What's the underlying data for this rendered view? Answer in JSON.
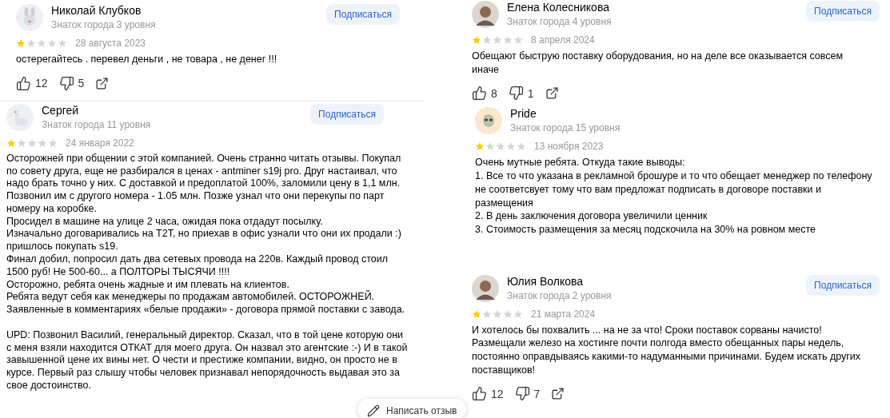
{
  "columns": [
    {
      "reviews": [
        {
          "avatar": {
            "kind": "bunny"
          },
          "name": "Николай Клубков",
          "level": "Знаток города 3 уровня",
          "subscribe": "Подписаться",
          "stars": 1,
          "date": "28 августа 2023",
          "text": "остерегайтесь . перевел деньги , не товара , не денег !!!",
          "likes": "12",
          "dislikes": "5"
        },
        {
          "avatar": {
            "kind": "goose"
          },
          "name": "Сергей",
          "level": "Знаток города 11 уровня",
          "subscribe": "Подписаться",
          "stars": 1,
          "date": "24 января 2022",
          "text": "Осторожней при общении с этой компанией. Очень странно читать отзывы. Покупал\nпо совету друга, еще не разбирался в ценах - antminer s19j pro. Друг настаивал, что\nнадо брать точно у них. С доставкой и предоплатой 100%, заломили цену в 1,1 млн.\nПозвонил им с другого номера - 1.05 млн. Позже узнал что они перекупы по парт\nномеру на коробке.\nПросидел в машине на улице 2 часа, ожидая пока отдадут посылку.\nИзначально договаривались на T2T, но приехав в офис узнали что они их продали :)\nпришлось покупать s19.\nФинал добил, попросил дать два сетевых провода на 220в. Каждый провод стоил\n1500 руб! Не 500-60... а ПОЛТОРЫ ТЫСЯЧИ !!!!\nОсторожно, ребята очень жадные и им плевать на клиентов.\nРебята ведут себя как менеджеры по продажам автомобилей. ОСТОРОЖНЕЙ.\nЗаявленные в комментариях «белые продажи» - договора прямой поставки с завода.\n\nUPD: Позвонил Василий, генеральный директор. Сказал, что в той цене которую они\nс меня взяли находится ОТКАТ для моего друга. Он назвал это агентские :-) И в такой\nзавышенной цене их вины нет. О чести и престиже компании, видно, он просто не в\nкурсе. Первый раз слышу чтобы человек признавал непорядочность выдавая это за\nсвое достоинство."
        }
      ]
    },
    {
      "reviews": [
        {
          "avatar": {
            "kind": "person"
          },
          "name": "Елена Колесникова",
          "level": "Знаток города 4 уровня",
          "subscribe": "Подписаться",
          "stars": 1,
          "date": "8 апреля 2024",
          "text": "Обещают быструю поставку оборудования, но на деле все оказывается совсем\nиначе",
          "likes": "8",
          "dislikes": "1"
        },
        {
          "avatar": {
            "kind": "alien"
          },
          "name": "Pride",
          "level": "Знаток города 15 уровня",
          "stars": 1,
          "date": "13 ноября 2023",
          "text": "Очень мутные ребята. Откуда такие выводы:\n1. Все то что указана в рекламной брошуре и то что обещает менеджер по телефону\nне соответсвует тому что вам предложат подписать в договоре поставки и\nразмещения\n2. В день заключения договора увеличили ценник\n3. Стоимость размещения за месяц подскочила на 30% на ровном месте"
        },
        {
          "avatar": {
            "kind": "person"
          },
          "name": "Юлия Волкова",
          "level": "Знаток города 2 уровня",
          "subscribe": "Подписаться",
          "stars": 1,
          "date": "21 марта 2024",
          "text": "И хотелось бы похвалить ... на не за что! Сроки поставок сорваны начисто!\nРазмещали железо на хостинге почти полгода вместо обещанных пары недель,\nпостоянно оправдываясь какими-то надуманными причинами. Будем искать других\nпоставщиков!",
          "likes": "12",
          "dislikes": "7"
        }
      ]
    }
  ],
  "write_review": {
    "label": "Написать отзыв"
  }
}
